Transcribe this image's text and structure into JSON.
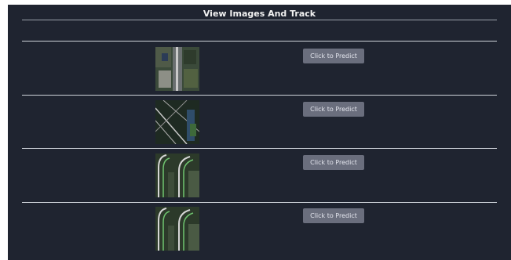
{
  "page": {
    "title": "View Images And Track"
  },
  "rows": [
    {
      "button_label": "Click to Predict",
      "thumbnail": "aerial-city-image"
    },
    {
      "button_label": "Click to Predict",
      "thumbnail": "aerial-roads-image"
    },
    {
      "button_label": "Click to Predict",
      "thumbnail": "aerial-road-tracks-image"
    },
    {
      "button_label": "Click to Predict",
      "thumbnail": "aerial-road-tracks-image"
    }
  ],
  "colors": {
    "panel_bg": "#1f2430",
    "button_bg": "#6a6e7d",
    "divider": "#cfd3da"
  }
}
